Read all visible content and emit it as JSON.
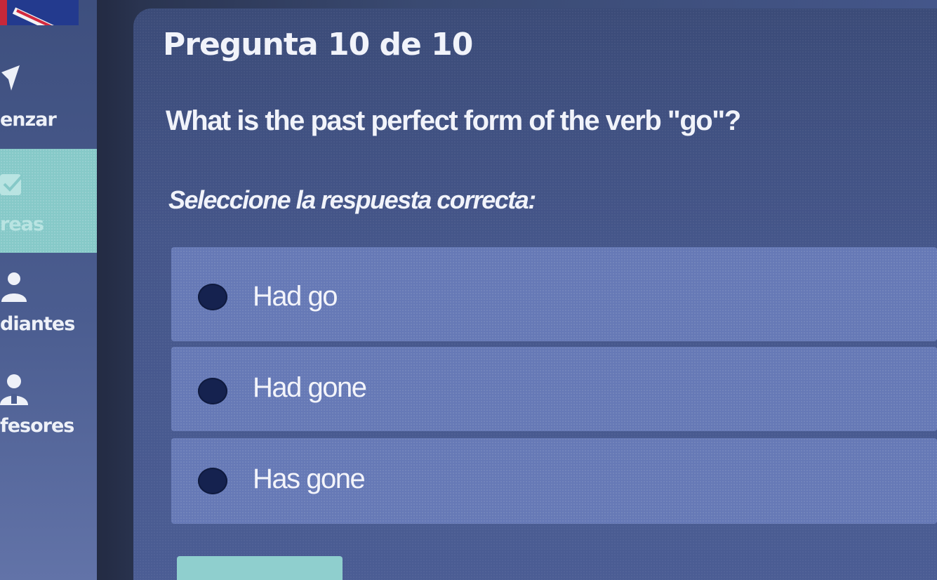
{
  "sidebar": {
    "language_flag_icon": "uk-flag-icon",
    "items": [
      {
        "label": "enzar",
        "icon": "paper-plane-icon"
      },
      {
        "label": "reas",
        "icon": "check-icon",
        "active": true
      },
      {
        "label": "diantes",
        "icon": "user-icon"
      },
      {
        "label": "fesores",
        "icon": "teacher-icon"
      }
    ],
    "active_color": "#86c9c8"
  },
  "question": {
    "title": "Pregunta 10 de 10",
    "text": "What is the past perfect form of the verb \"go\"?",
    "instruction": "Seleccione la respuesta correcta:",
    "options": [
      {
        "label": "Had go"
      },
      {
        "label": "Had gone"
      },
      {
        "label": "Has gone"
      }
    ]
  },
  "colors": {
    "option_bg": "#6679b6",
    "radio": "#15224f",
    "submit_button": "#8fcfce"
  }
}
